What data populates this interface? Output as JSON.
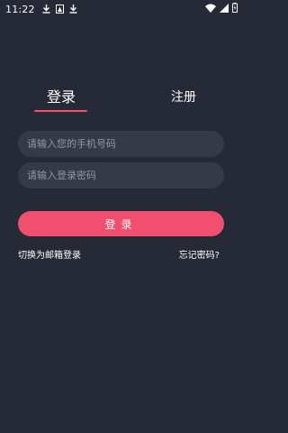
{
  "status_bar": {
    "time": "11:22",
    "left_icons": [
      "download-icon",
      "image-icon",
      "download-icon"
    ],
    "right_icons": [
      "wifi-icon",
      "signal-icon",
      "battery-icon"
    ]
  },
  "tabs": {
    "login": "登录",
    "register": "注册",
    "active": "login"
  },
  "form": {
    "phone_placeholder": "请输入您的手机号码",
    "password_placeholder": "请输入登录密码",
    "phone_value": "",
    "password_value": ""
  },
  "actions": {
    "login_button": "登录",
    "switch_email": "切换为邮箱登录",
    "forgot_password": "忘记密码?"
  },
  "colors": {
    "background": "#252a36",
    "input_background": "#353a47",
    "accent": "#f0506e"
  }
}
